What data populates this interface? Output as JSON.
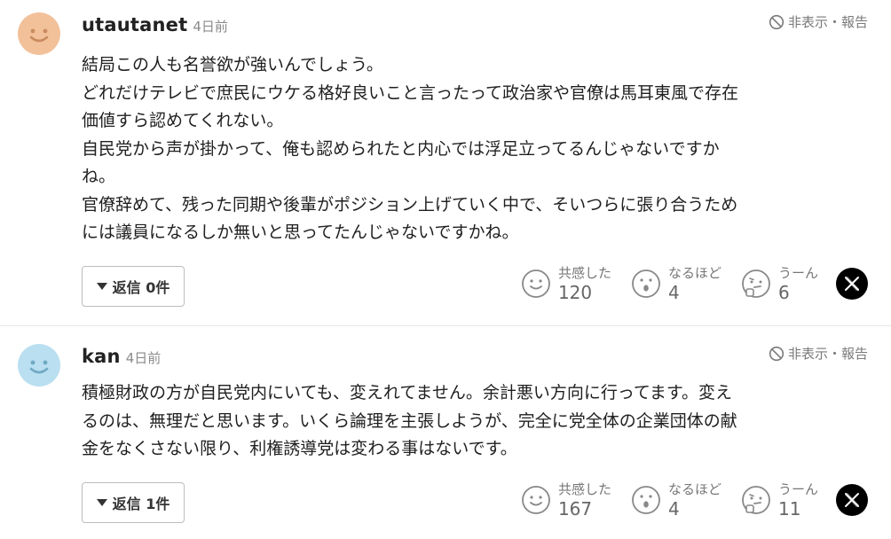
{
  "colors": {
    "avatar_first": "#f2c19a",
    "avatar_second": "#b9dff0",
    "text": "#1f1f1f",
    "muted": "#8a8a8a"
  },
  "comments": [
    {
      "username": "utautanet",
      "time": "4日前",
      "report": "非表示・報告",
      "lines": [
        "結局この人も名誉欲が強いんでしょう。",
        "どれだけテレビで庶民にウケる格好良いこと言ったって政治家や官僚は馬耳東風で存在",
        "価値すら認めてくれない。",
        "自民党から声が掛かって、俺も認められたと内心では浮足立ってるんじゃないですか",
        "ね。",
        "官僚辞めて、残った同期や後輩がポジション上げていく中で、そいつらに張り合うため",
        "には議員になるしか無いと思ってたんじゃないですかね。"
      ],
      "reply_label": "返信 0件",
      "reactions": [
        {
          "label": "共感した",
          "count": "120",
          "icon": "smile-icon"
        },
        {
          "label": "なるほど",
          "count": "4",
          "icon": "surprised-icon"
        },
        {
          "label": "うーん",
          "count": "6",
          "icon": "thinking-icon"
        }
      ],
      "share_icon": "x-logo-icon"
    },
    {
      "username": "kan",
      "time": "4日前",
      "report": "非表示・報告",
      "lines": [
        "積極財政の方が自民党内にいても、変えれてません。余計悪い方向に行ってます。変え",
        "るのは、無理だと思います。いくら論理を主張しようが、完全に党全体の企業団体の献",
        "金をなくさない限り、利権誘導党は変わる事はないです。"
      ],
      "reply_label": "返信 1件",
      "reactions": [
        {
          "label": "共感した",
          "count": "167",
          "icon": "smile-icon"
        },
        {
          "label": "なるほど",
          "count": "4",
          "icon": "surprised-icon"
        },
        {
          "label": "うーん",
          "count": "11",
          "icon": "thinking-icon"
        }
      ],
      "share_icon": "x-logo-icon"
    }
  ]
}
